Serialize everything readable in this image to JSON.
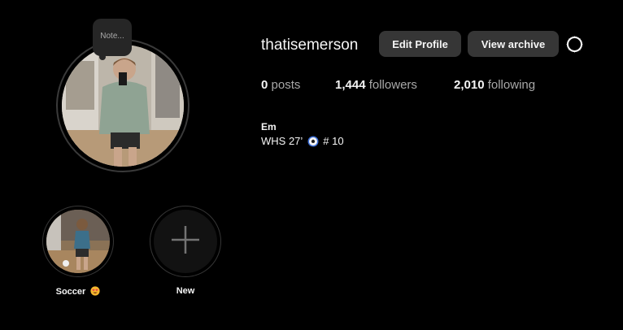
{
  "profile": {
    "username": "thatisemerson",
    "note": "Note...",
    "display_name": "Em",
    "bio_prefix": "WHS 27’",
    "bio_suffix": "# 10"
  },
  "buttons": {
    "edit_profile": "Edit Profile",
    "view_archive": "View archive"
  },
  "stats": {
    "posts_count": "0",
    "posts_label": "posts",
    "followers_count": "1,444",
    "followers_label": "followers",
    "following_count": "2,010",
    "following_label": "following"
  },
  "highlights": [
    {
      "label": "Soccer"
    },
    {
      "label": "New"
    }
  ],
  "icons": {
    "settings": "gear-icon",
    "bio_emoji": "soccer-ball-icon",
    "highlight_emoji": "heart-eyes-emoji-icon",
    "new_highlight": "plus-icon"
  },
  "colors": {
    "background": "#000000",
    "button_bg": "#363636",
    "text_primary": "#f5f5f5",
    "text_secondary": "#a8a8a8"
  }
}
